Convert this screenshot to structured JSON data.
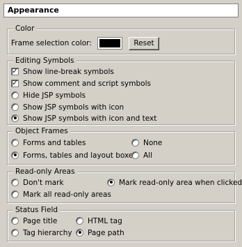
{
  "title": "Appearance",
  "color": {
    "legend": "Color",
    "label": "Frame selection color:",
    "swatch_color": "#000000",
    "reset_label": "Reset"
  },
  "editing": {
    "legend": "Editing Symbols",
    "items": [
      {
        "label": "Show line-break symbols",
        "type": "checkbox",
        "checked": true
      },
      {
        "label": "Show comment and script symbols",
        "type": "checkbox",
        "checked": true
      },
      {
        "label": "Hide JSP symbols",
        "type": "radio",
        "checked": false
      },
      {
        "label": "Show JSP symbols with icon",
        "type": "radio",
        "checked": false
      },
      {
        "label": "Show JSP symbols with icon and text",
        "type": "radio",
        "checked": true
      }
    ]
  },
  "frames": {
    "legend": "Object Frames",
    "forms_and_tables": "Forms and tables",
    "none": "None",
    "forms_tables_layout": "Forms, tables and layout boxes",
    "all": "All",
    "selected": "Forms, tables and layout boxes"
  },
  "readonly": {
    "legend": "Read-only Areas",
    "dont_mark": "Don't mark",
    "mark_when_clicked": "Mark read-only area when clicked",
    "mark_all": "Mark all read-only areas",
    "selected": "Mark read-only area when clicked"
  },
  "status": {
    "legend": "Status Field",
    "page_title": "Page title",
    "html_tag": "HTML tag",
    "tag_hierarchy": "Tag hierarchy",
    "page_path": "Page path",
    "selected": "Page path"
  }
}
